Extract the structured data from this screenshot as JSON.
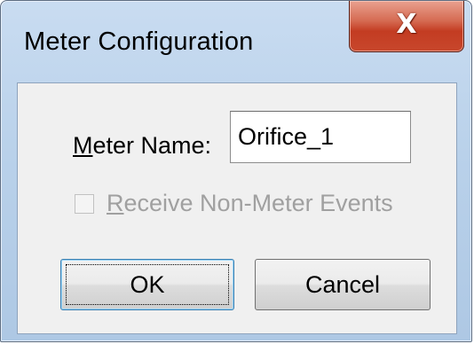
{
  "window": {
    "title": "Meter Configuration",
    "close_glyph": "X",
    "close_icon": "close-icon"
  },
  "form": {
    "meter_name_label_accesskey": "M",
    "meter_name_label_rest": "eter Name:",
    "meter_name_value": "Orifice_1",
    "receive_events_accesskey": "R",
    "receive_events_rest": "eceive Non-Meter Events",
    "receive_events_checked": false,
    "receive_events_enabled": false
  },
  "buttons": {
    "ok_label": "OK",
    "cancel_label": "Cancel"
  },
  "colors": {
    "title_bar": "#b9d1ea",
    "close_button": "#c8472c",
    "client_area": "#f0f0f0",
    "disabled_text": "#a0a0a0"
  }
}
